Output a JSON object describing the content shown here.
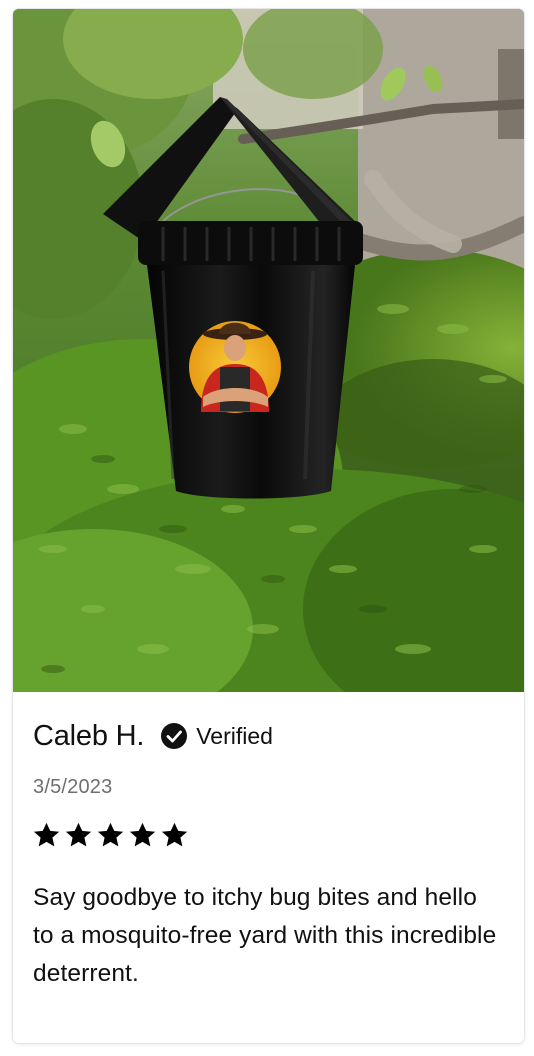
{
  "review": {
    "reviewer_name": "Caleb H.",
    "verified_label": "Verified",
    "date": "3/5/2023",
    "rating": 5,
    "rating_max": 5,
    "text": "Say goodbye to itchy bug bites and hello to a mosquito-free yard with this incredible deterrent."
  },
  "photo": {
    "subject": "black-bucket-mosquito-trap-with-farmer-logo",
    "logo_icon": "farmer-mascot-logo"
  },
  "icons": {
    "verified": "verified-check-icon",
    "star": "star-icon"
  },
  "colors": {
    "text_primary": "#111111",
    "text_secondary": "#6f6f6f",
    "star": "#000000",
    "card_border": "#e6e6e6"
  }
}
